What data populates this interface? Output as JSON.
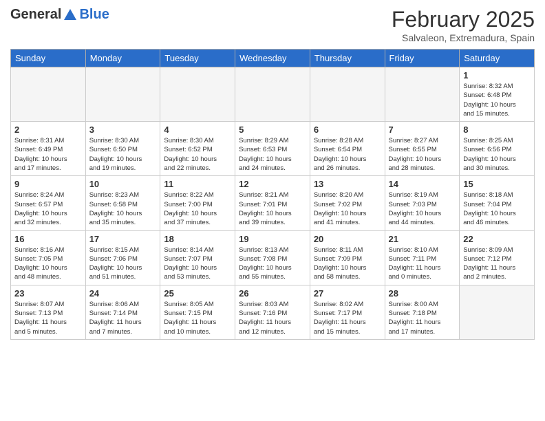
{
  "header": {
    "logo_general": "General",
    "logo_blue": "Blue",
    "title": "February 2025",
    "location": "Salvaleon, Extremadura, Spain"
  },
  "weekdays": [
    "Sunday",
    "Monday",
    "Tuesday",
    "Wednesday",
    "Thursday",
    "Friday",
    "Saturday"
  ],
  "weeks": [
    [
      {
        "num": "",
        "detail": ""
      },
      {
        "num": "",
        "detail": ""
      },
      {
        "num": "",
        "detail": ""
      },
      {
        "num": "",
        "detail": ""
      },
      {
        "num": "",
        "detail": ""
      },
      {
        "num": "",
        "detail": ""
      },
      {
        "num": "1",
        "detail": "Sunrise: 8:32 AM\nSunset: 6:48 PM\nDaylight: 10 hours\nand 15 minutes."
      }
    ],
    [
      {
        "num": "2",
        "detail": "Sunrise: 8:31 AM\nSunset: 6:49 PM\nDaylight: 10 hours\nand 17 minutes."
      },
      {
        "num": "3",
        "detail": "Sunrise: 8:30 AM\nSunset: 6:50 PM\nDaylight: 10 hours\nand 19 minutes."
      },
      {
        "num": "4",
        "detail": "Sunrise: 8:30 AM\nSunset: 6:52 PM\nDaylight: 10 hours\nand 22 minutes."
      },
      {
        "num": "5",
        "detail": "Sunrise: 8:29 AM\nSunset: 6:53 PM\nDaylight: 10 hours\nand 24 minutes."
      },
      {
        "num": "6",
        "detail": "Sunrise: 8:28 AM\nSunset: 6:54 PM\nDaylight: 10 hours\nand 26 minutes."
      },
      {
        "num": "7",
        "detail": "Sunrise: 8:27 AM\nSunset: 6:55 PM\nDaylight: 10 hours\nand 28 minutes."
      },
      {
        "num": "8",
        "detail": "Sunrise: 8:25 AM\nSunset: 6:56 PM\nDaylight: 10 hours\nand 30 minutes."
      }
    ],
    [
      {
        "num": "9",
        "detail": "Sunrise: 8:24 AM\nSunset: 6:57 PM\nDaylight: 10 hours\nand 32 minutes."
      },
      {
        "num": "10",
        "detail": "Sunrise: 8:23 AM\nSunset: 6:58 PM\nDaylight: 10 hours\nand 35 minutes."
      },
      {
        "num": "11",
        "detail": "Sunrise: 8:22 AM\nSunset: 7:00 PM\nDaylight: 10 hours\nand 37 minutes."
      },
      {
        "num": "12",
        "detail": "Sunrise: 8:21 AM\nSunset: 7:01 PM\nDaylight: 10 hours\nand 39 minutes."
      },
      {
        "num": "13",
        "detail": "Sunrise: 8:20 AM\nSunset: 7:02 PM\nDaylight: 10 hours\nand 41 minutes."
      },
      {
        "num": "14",
        "detail": "Sunrise: 8:19 AM\nSunset: 7:03 PM\nDaylight: 10 hours\nand 44 minutes."
      },
      {
        "num": "15",
        "detail": "Sunrise: 8:18 AM\nSunset: 7:04 PM\nDaylight: 10 hours\nand 46 minutes."
      }
    ],
    [
      {
        "num": "16",
        "detail": "Sunrise: 8:16 AM\nSunset: 7:05 PM\nDaylight: 10 hours\nand 48 minutes."
      },
      {
        "num": "17",
        "detail": "Sunrise: 8:15 AM\nSunset: 7:06 PM\nDaylight: 10 hours\nand 51 minutes."
      },
      {
        "num": "18",
        "detail": "Sunrise: 8:14 AM\nSunset: 7:07 PM\nDaylight: 10 hours\nand 53 minutes."
      },
      {
        "num": "19",
        "detail": "Sunrise: 8:13 AM\nSunset: 7:08 PM\nDaylight: 10 hours\nand 55 minutes."
      },
      {
        "num": "20",
        "detail": "Sunrise: 8:11 AM\nSunset: 7:09 PM\nDaylight: 10 hours\nand 58 minutes."
      },
      {
        "num": "21",
        "detail": "Sunrise: 8:10 AM\nSunset: 7:11 PM\nDaylight: 11 hours\nand 0 minutes."
      },
      {
        "num": "22",
        "detail": "Sunrise: 8:09 AM\nSunset: 7:12 PM\nDaylight: 11 hours\nand 2 minutes."
      }
    ],
    [
      {
        "num": "23",
        "detail": "Sunrise: 8:07 AM\nSunset: 7:13 PM\nDaylight: 11 hours\nand 5 minutes."
      },
      {
        "num": "24",
        "detail": "Sunrise: 8:06 AM\nSunset: 7:14 PM\nDaylight: 11 hours\nand 7 minutes."
      },
      {
        "num": "25",
        "detail": "Sunrise: 8:05 AM\nSunset: 7:15 PM\nDaylight: 11 hours\nand 10 minutes."
      },
      {
        "num": "26",
        "detail": "Sunrise: 8:03 AM\nSunset: 7:16 PM\nDaylight: 11 hours\nand 12 minutes."
      },
      {
        "num": "27",
        "detail": "Sunrise: 8:02 AM\nSunset: 7:17 PM\nDaylight: 11 hours\nand 15 minutes."
      },
      {
        "num": "28",
        "detail": "Sunrise: 8:00 AM\nSunset: 7:18 PM\nDaylight: 11 hours\nand 17 minutes."
      },
      {
        "num": "",
        "detail": ""
      }
    ]
  ]
}
